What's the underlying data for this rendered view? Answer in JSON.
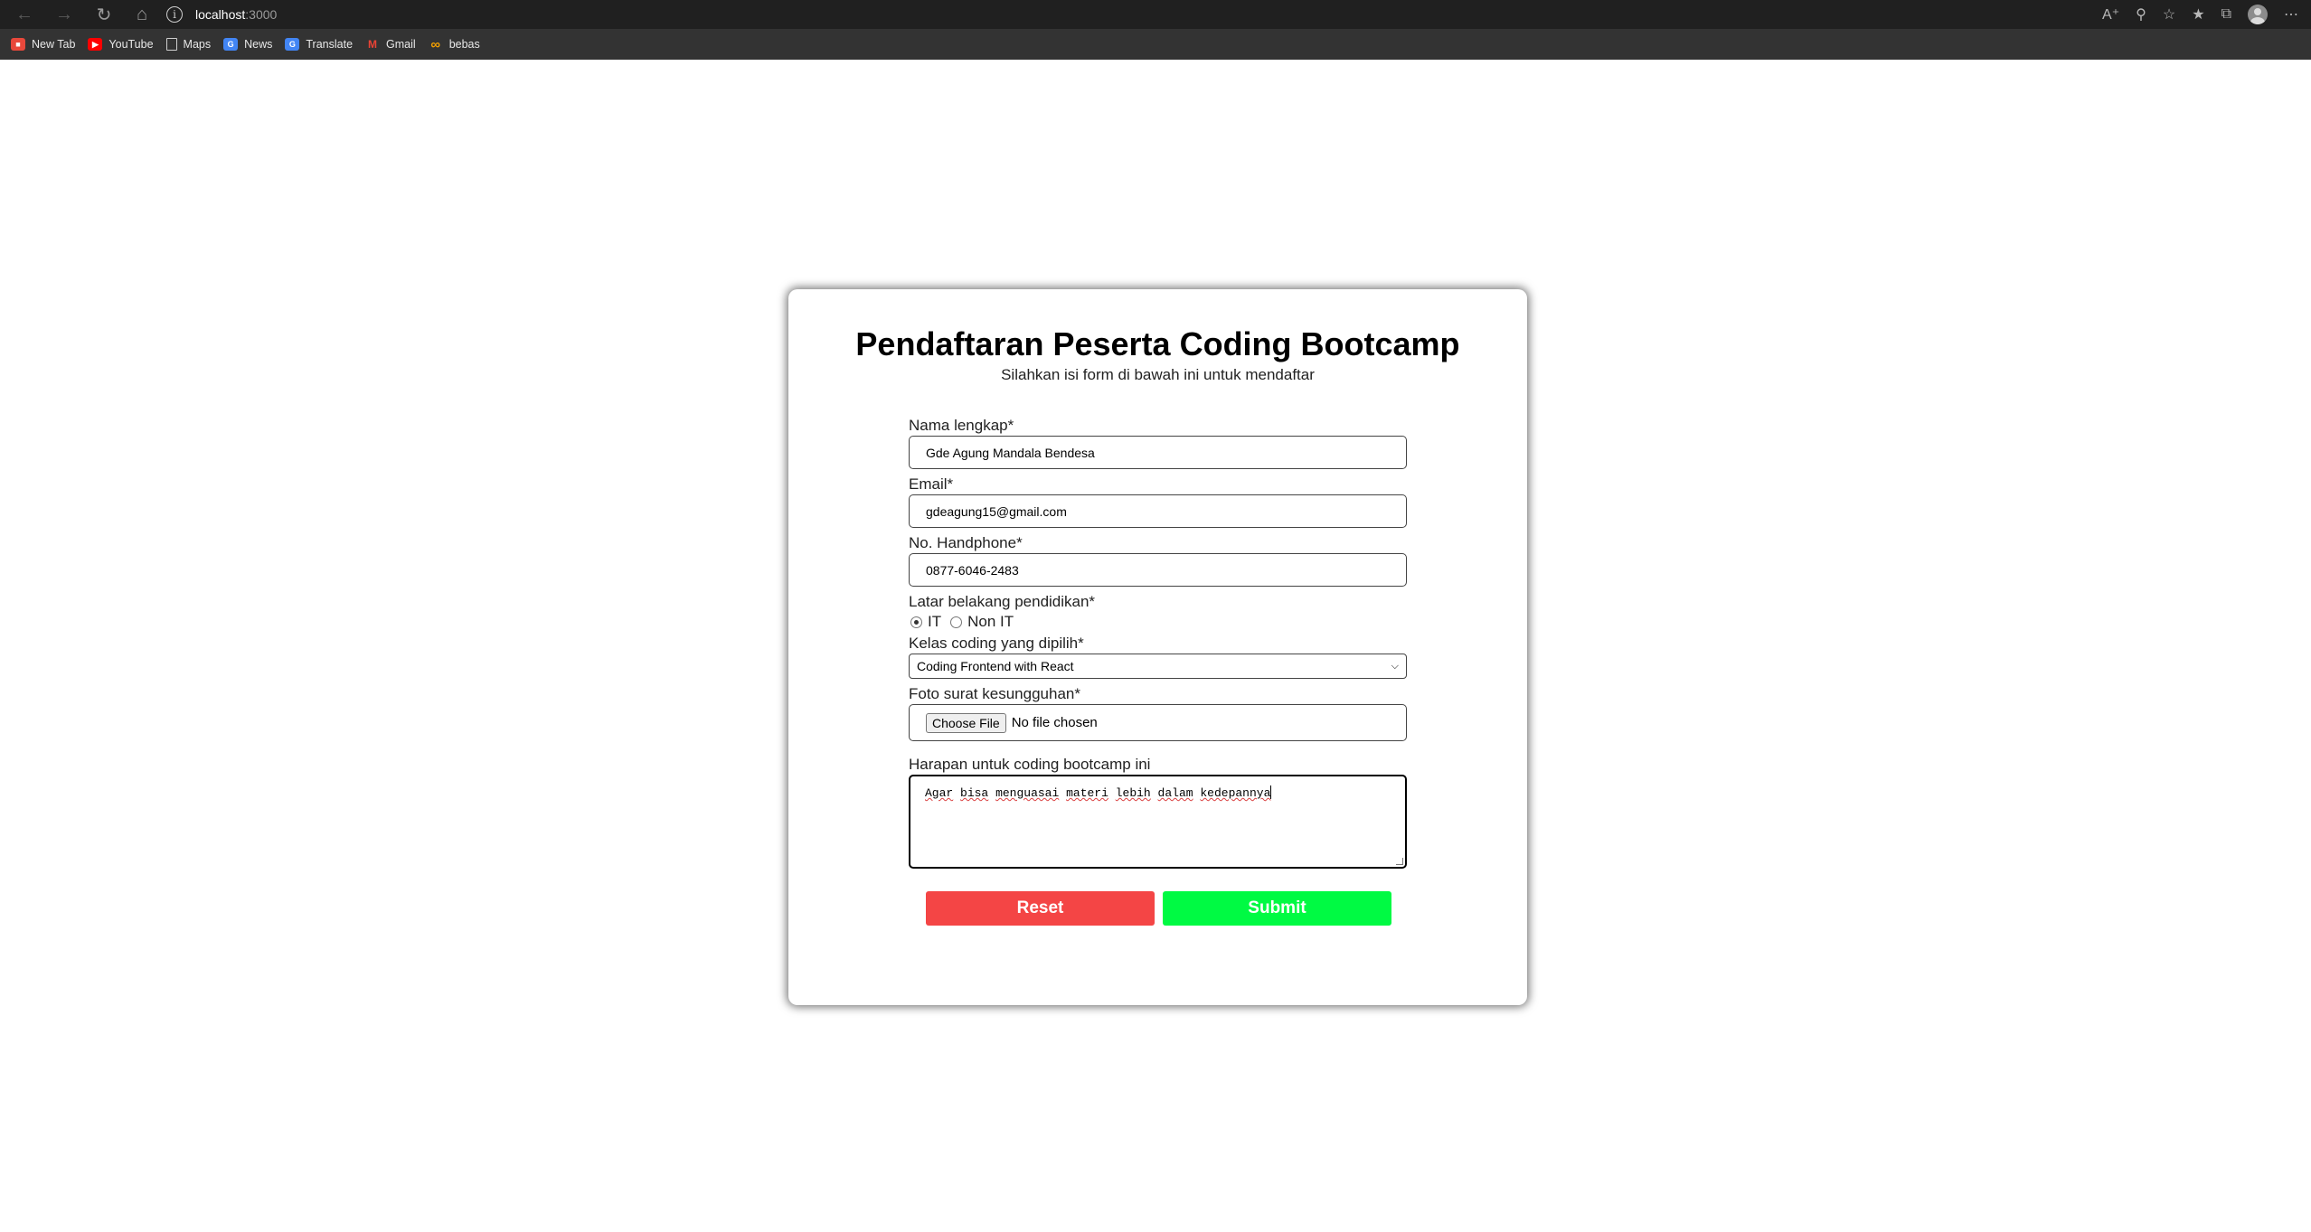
{
  "browser": {
    "url_host": "localhost",
    "url_port": ":3000",
    "bookmarks": [
      {
        "label": "New Tab",
        "color": "#e8483b"
      },
      {
        "label": "YouTube",
        "color": "#ff0000"
      },
      {
        "label": "Maps",
        "color": "#5f6368"
      },
      {
        "label": "News",
        "color": "#4285f4"
      },
      {
        "label": "Translate",
        "color": "#4285f4"
      },
      {
        "label": "Gmail",
        "color": "#ea4335"
      },
      {
        "label": "bebas",
        "color": "#f4a000"
      }
    ]
  },
  "page": {
    "title": "Pendaftaran Peserta Coding Bootcamp",
    "subtitle": "Silahkan isi form di bawah ini untuk mendaftar"
  },
  "form": {
    "name": {
      "label": "Nama lengkap*",
      "value": "Gde Agung Mandala Bendesa"
    },
    "email": {
      "label": "Email*",
      "value": "gdeagung15@gmail.com"
    },
    "phone": {
      "label": "No. Handphone*",
      "value": "0877-6046-2483"
    },
    "education": {
      "label": "Latar belakang pendidikan*",
      "options": [
        "IT",
        "Non IT"
      ],
      "selected": "IT"
    },
    "class": {
      "label": "Kelas coding yang dipilih*",
      "value": "Coding Frontend with React"
    },
    "file": {
      "label": "Foto surat kesungguhan*",
      "button": "Choose File",
      "status": "No file chosen"
    },
    "hope": {
      "label": "Harapan untuk coding bootcamp ini",
      "words": [
        "Agar",
        "bisa",
        "menguasai",
        "materi",
        "lebih",
        "dalam",
        "kedepannya"
      ]
    },
    "reset_label": "Reset",
    "submit_label": "Submit"
  },
  "colors": {
    "reset": "#f44545",
    "submit": "#00fa43"
  }
}
